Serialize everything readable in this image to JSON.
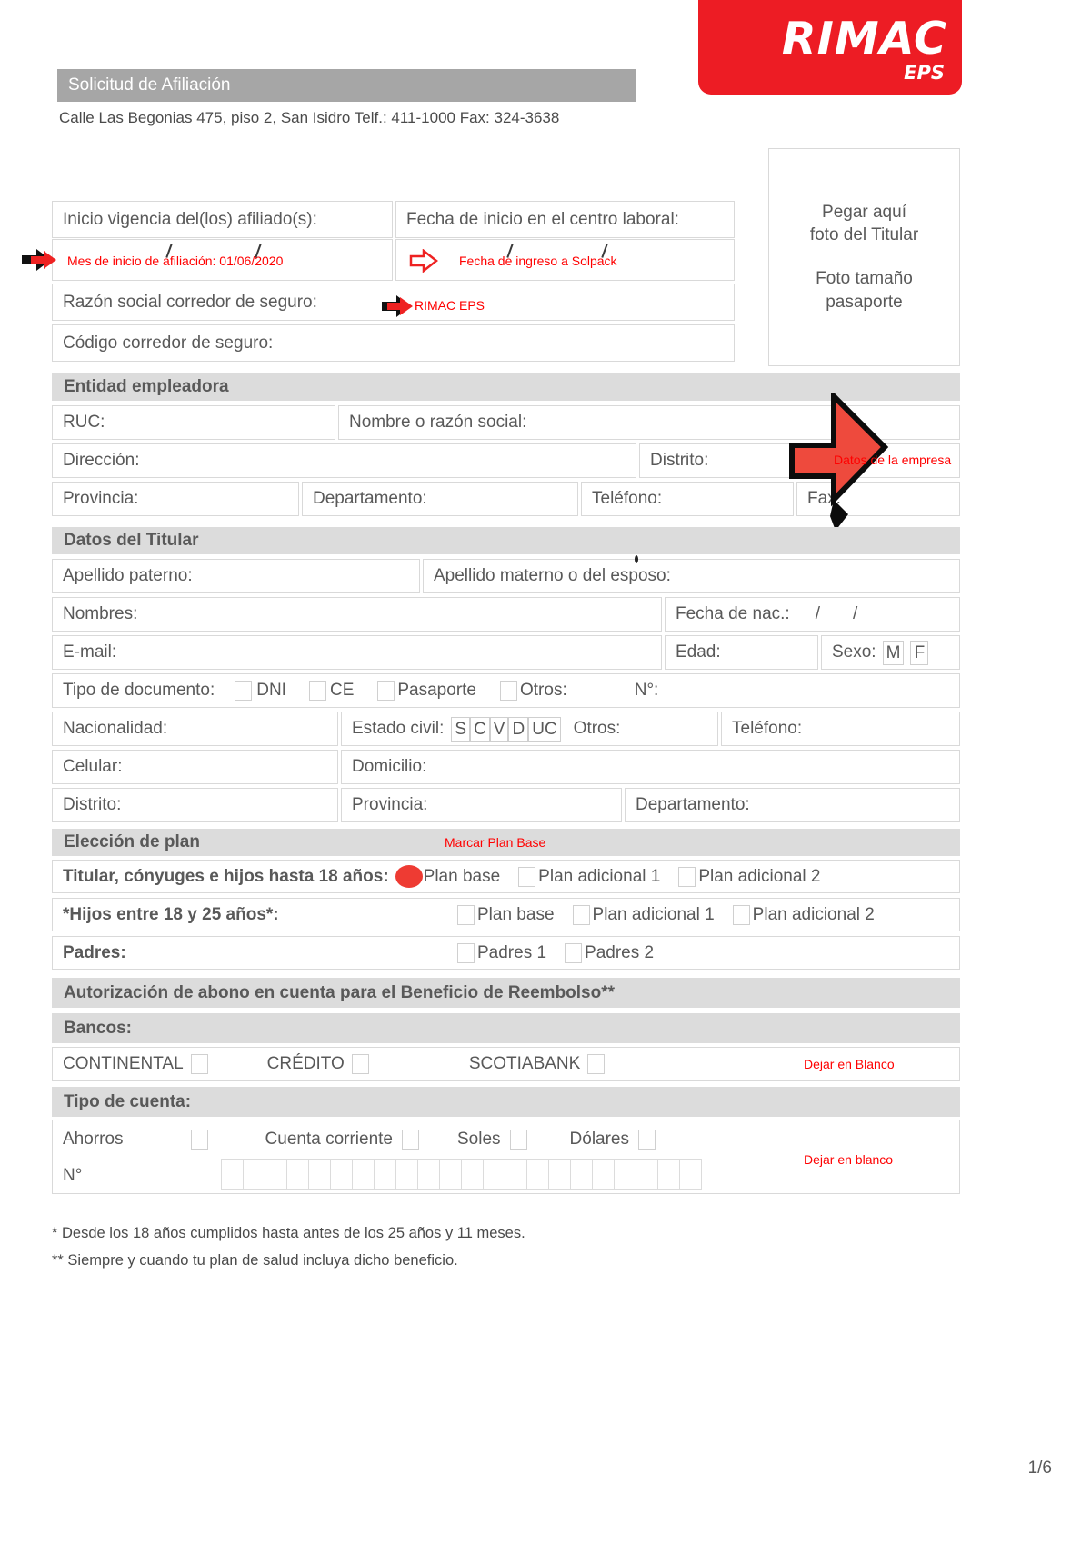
{
  "brand": {
    "name": "RIMAC",
    "sub": "EPS",
    "color": "#ed1c24"
  },
  "header": {
    "title": "Solicitud de Afiliación",
    "address": "Calle Las Begonias 475, piso 2, San Isidro  Telf.: 411-1000  Fax: 324-3638"
  },
  "photo_box": {
    "line1": "Pegar aquí",
    "line2": "foto del Titular",
    "line3": "Foto tamaño",
    "line4": "pasaporte"
  },
  "top_fields": {
    "inicio_vigencia": "Inicio vigencia del(los) afiliado(s):",
    "fecha_inicio_centro": "Fecha de inicio en el centro laboral:",
    "razon_social_corredor": "Razón social corredor de seguro:",
    "codigo_corredor": "Código corredor de seguro:"
  },
  "annotations": {
    "mes_inicio": "Mes de inicio de afiliación: 01/06/2020",
    "fecha_ingreso": "Fecha de ingreso a Solpack",
    "rimac_eps": "RIMAC EPS",
    "datos_empresa": "Datos de la empresa",
    "marcar_plan_base": "Marcar Plan Base",
    "dejar_en_blanco_bancos": "Dejar en Blanco",
    "dejar_en_blanco_cuenta": "Dejar en blanco"
  },
  "entidad_empleadora": {
    "section_title": "Entidad empleadora",
    "ruc": "RUC:",
    "nombre_razon_social": "Nombre o razón social:",
    "direccion": "Dirección:",
    "distrito": "Distrito:",
    "provincia": "Provincia:",
    "departamento": "Departamento:",
    "telefono": "Teléfono:",
    "fax": "Fax:"
  },
  "datos_titular": {
    "section_title": "Datos del Titular",
    "apellido_paterno": "Apellido paterno:",
    "apellido_materno": "Apellido materno o del esposo:",
    "nombres": "Nombres:",
    "fecha_nac": "Fecha de nac.:",
    "fecha_nac_sep1": "/",
    "fecha_nac_sep2": "/",
    "email": "E-mail:",
    "edad": "Edad:",
    "sexo": "Sexo:",
    "sexo_m": "M",
    "sexo_f": "F",
    "tipo_documento": "Tipo de documento:",
    "doc_dni": "DNI",
    "doc_ce": "CE",
    "doc_pasaporte": "Pasaporte",
    "doc_otros": "Otros:",
    "numero": "N°:",
    "nacionalidad": "Nacionalidad:",
    "estado_civil": "Estado civil:",
    "ec_s": "S",
    "ec_c": "C",
    "ec_v": "V",
    "ec_d": "D",
    "ec_uc": "UC",
    "ec_otros": "Otros:",
    "telefono": "Teléfono:",
    "celular": "Celular:",
    "domicilio": "Domicilio:",
    "distrito": "Distrito:",
    "provincia": "Provincia:",
    "departamento": "Departamento:"
  },
  "eleccion_plan": {
    "section_title": "Elección de plan",
    "rows": [
      {
        "label": "Titular, cónyuges e hijos hasta 18 años:",
        "options": [
          "Plan base",
          "Plan adicional 1",
          "Plan adicional 2"
        ],
        "selected": 0
      },
      {
        "label": "*Hijos entre 18 y 25 años*:",
        "options": [
          "Plan base",
          "Plan adicional 1",
          "Plan adicional 2"
        ],
        "selected": -1
      },
      {
        "label": "Padres:",
        "options": [
          "Padres 1",
          "Padres 2"
        ],
        "selected": -1
      }
    ]
  },
  "reembolso": {
    "section_title": "Autorización de abono en cuenta para el Beneficio de Reembolso**",
    "bancos_title": "Bancos:",
    "bancos": [
      "CONTINENTAL",
      "CRÉDITO",
      "SCOTIABANK"
    ],
    "tipo_cuenta_title": "Tipo de cuenta:",
    "cuenta_options": [
      "Ahorros",
      "Cuenta corriente",
      "Soles",
      "Dólares"
    ],
    "numero_label": "N°",
    "numero_cells": 22
  },
  "footnotes": {
    "one": "* Desde los 18 años cumplidos hasta antes de los 25 años y 11 meses.",
    "two": "** Siempre y cuando tu plan de salud incluya dicho beneficio."
  },
  "page_number": "1/6"
}
